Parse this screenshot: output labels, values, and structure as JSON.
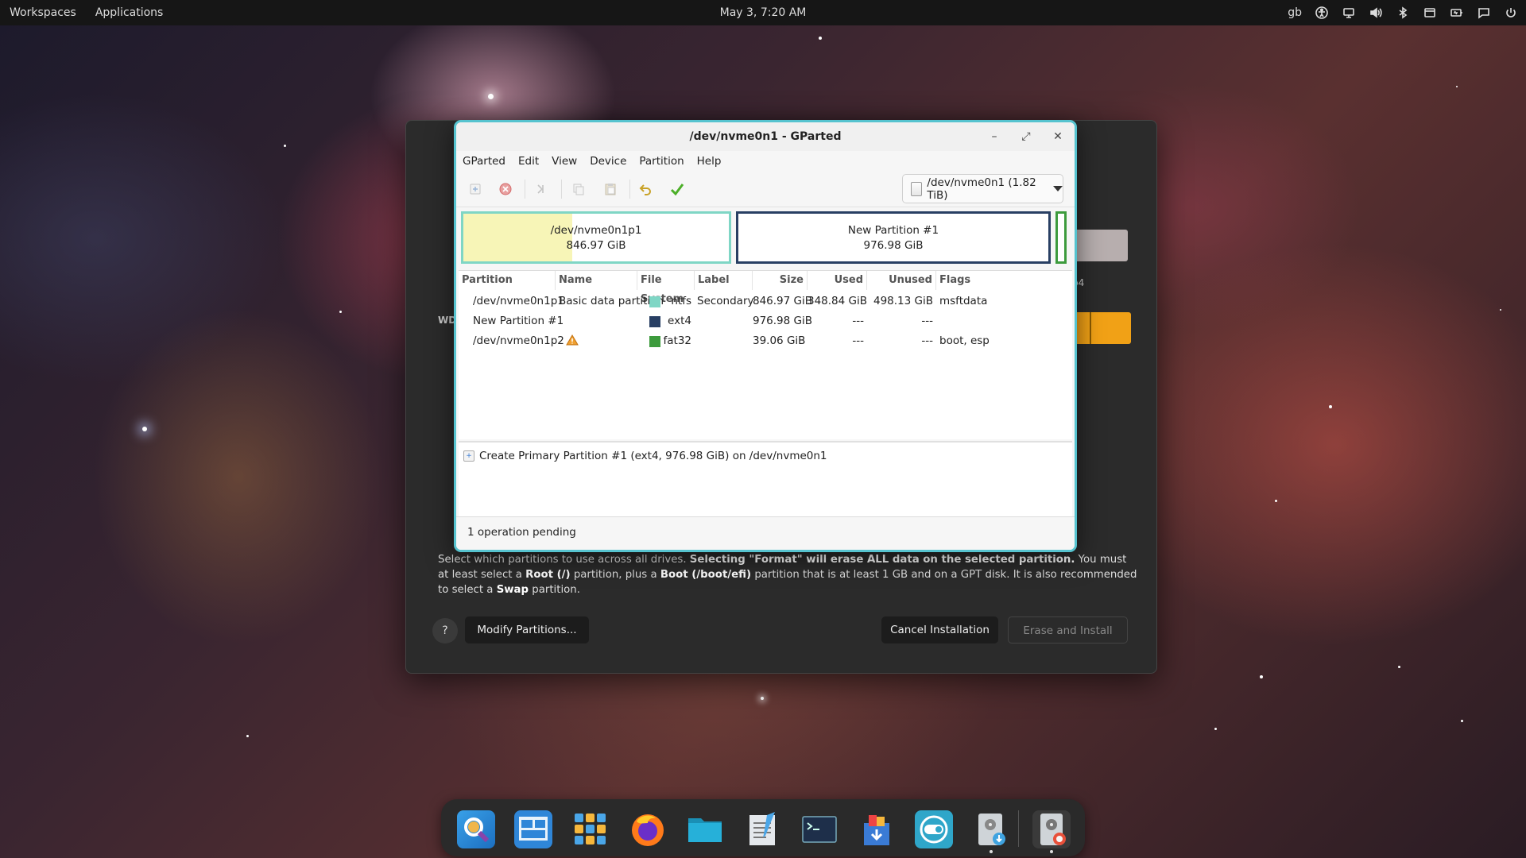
{
  "topbar": {
    "workspaces": "Workspaces",
    "applications": "Applications",
    "clock": "May 3, 7:20 AM",
    "keyboard_layout": "gb",
    "tray_icons": [
      "accessibility-icon",
      "display-icon",
      "volume-icon",
      "bluetooth-icon",
      "screen-icon",
      "battery-icon",
      "notification-icon",
      "power-icon"
    ]
  },
  "installer": {
    "disk_label": "WD",
    "partition_hint": "p4",
    "description_parts": {
      "p1": "Select which partitions to use across all drives. ",
      "b1": "Selecting \"Format\" will erase ALL data on the selected partition.",
      "p2": " You must at least select a ",
      "b2": "Root (/)",
      "p3": " partition, plus a ",
      "b3": "Boot (/boot/efi)",
      "p4": " partition that is at least 1 GB and on a GPT disk. It is also recommended to select a ",
      "b4": "Swap",
      "p5": " partition."
    },
    "help_label": "?",
    "modify_button": "Modify Partitions...",
    "cancel_button": "Cancel Installation",
    "erase_button": "Erase and Install"
  },
  "gparted": {
    "title": "/dev/nvme0n1 - GParted",
    "window_controls": {
      "minimize": "–",
      "maximize": "⤢",
      "close": "✕"
    },
    "menu": [
      "GParted",
      "Edit",
      "View",
      "Device",
      "Partition",
      "Help"
    ],
    "device_selector": "/dev/nvme0n1 (1.82 TiB)",
    "visual": {
      "p1_name": "/dev/nvme0n1p1",
      "p1_size": "846.97 GiB",
      "p1_used_fraction": 0.41,
      "new_name": "New Partition #1",
      "new_size": "976.98 GiB"
    },
    "columns": [
      "Partition",
      "Name",
      "File System",
      "Label",
      "Size",
      "Used",
      "Unused",
      "Flags"
    ],
    "rows": [
      {
        "partition": "/dev/nvme0n1p1",
        "name": "Basic data partition",
        "fs_color": "#7fd6c5",
        "fs": "ntfs",
        "label": "Secondary",
        "size": "846.97 GiB",
        "used": "348.84 GiB",
        "unused": "498.13 GiB",
        "flags": "msftdata"
      },
      {
        "partition": "New Partition #1",
        "name": "",
        "fs_color": "#283f63",
        "fs": "ext4",
        "label": "",
        "size": "976.98 GiB",
        "used": "---",
        "unused": "---",
        "flags": ""
      },
      {
        "partition": "/dev/nvme0n1p2",
        "name": "",
        "fs_color": "#3d9b3d",
        "fs": "fat32",
        "label": "",
        "size": "39.06 GiB",
        "used": "---",
        "unused": "---",
        "flags": "boot, esp"
      }
    ],
    "pending_operation": "Create Primary Partition #1 (ext4, 976.98 GiB) on /dev/nvme0n1",
    "status": "1 operation pending"
  },
  "dock": {
    "apps": [
      "search-app-icon",
      "workspaces-app-icon",
      "app-grid-icon",
      "firefox-icon",
      "files-icon",
      "text-editor-icon",
      "terminal-icon",
      "software-store-icon",
      "settings-app-icon",
      "installer-icon",
      "gparted-icon"
    ]
  }
}
